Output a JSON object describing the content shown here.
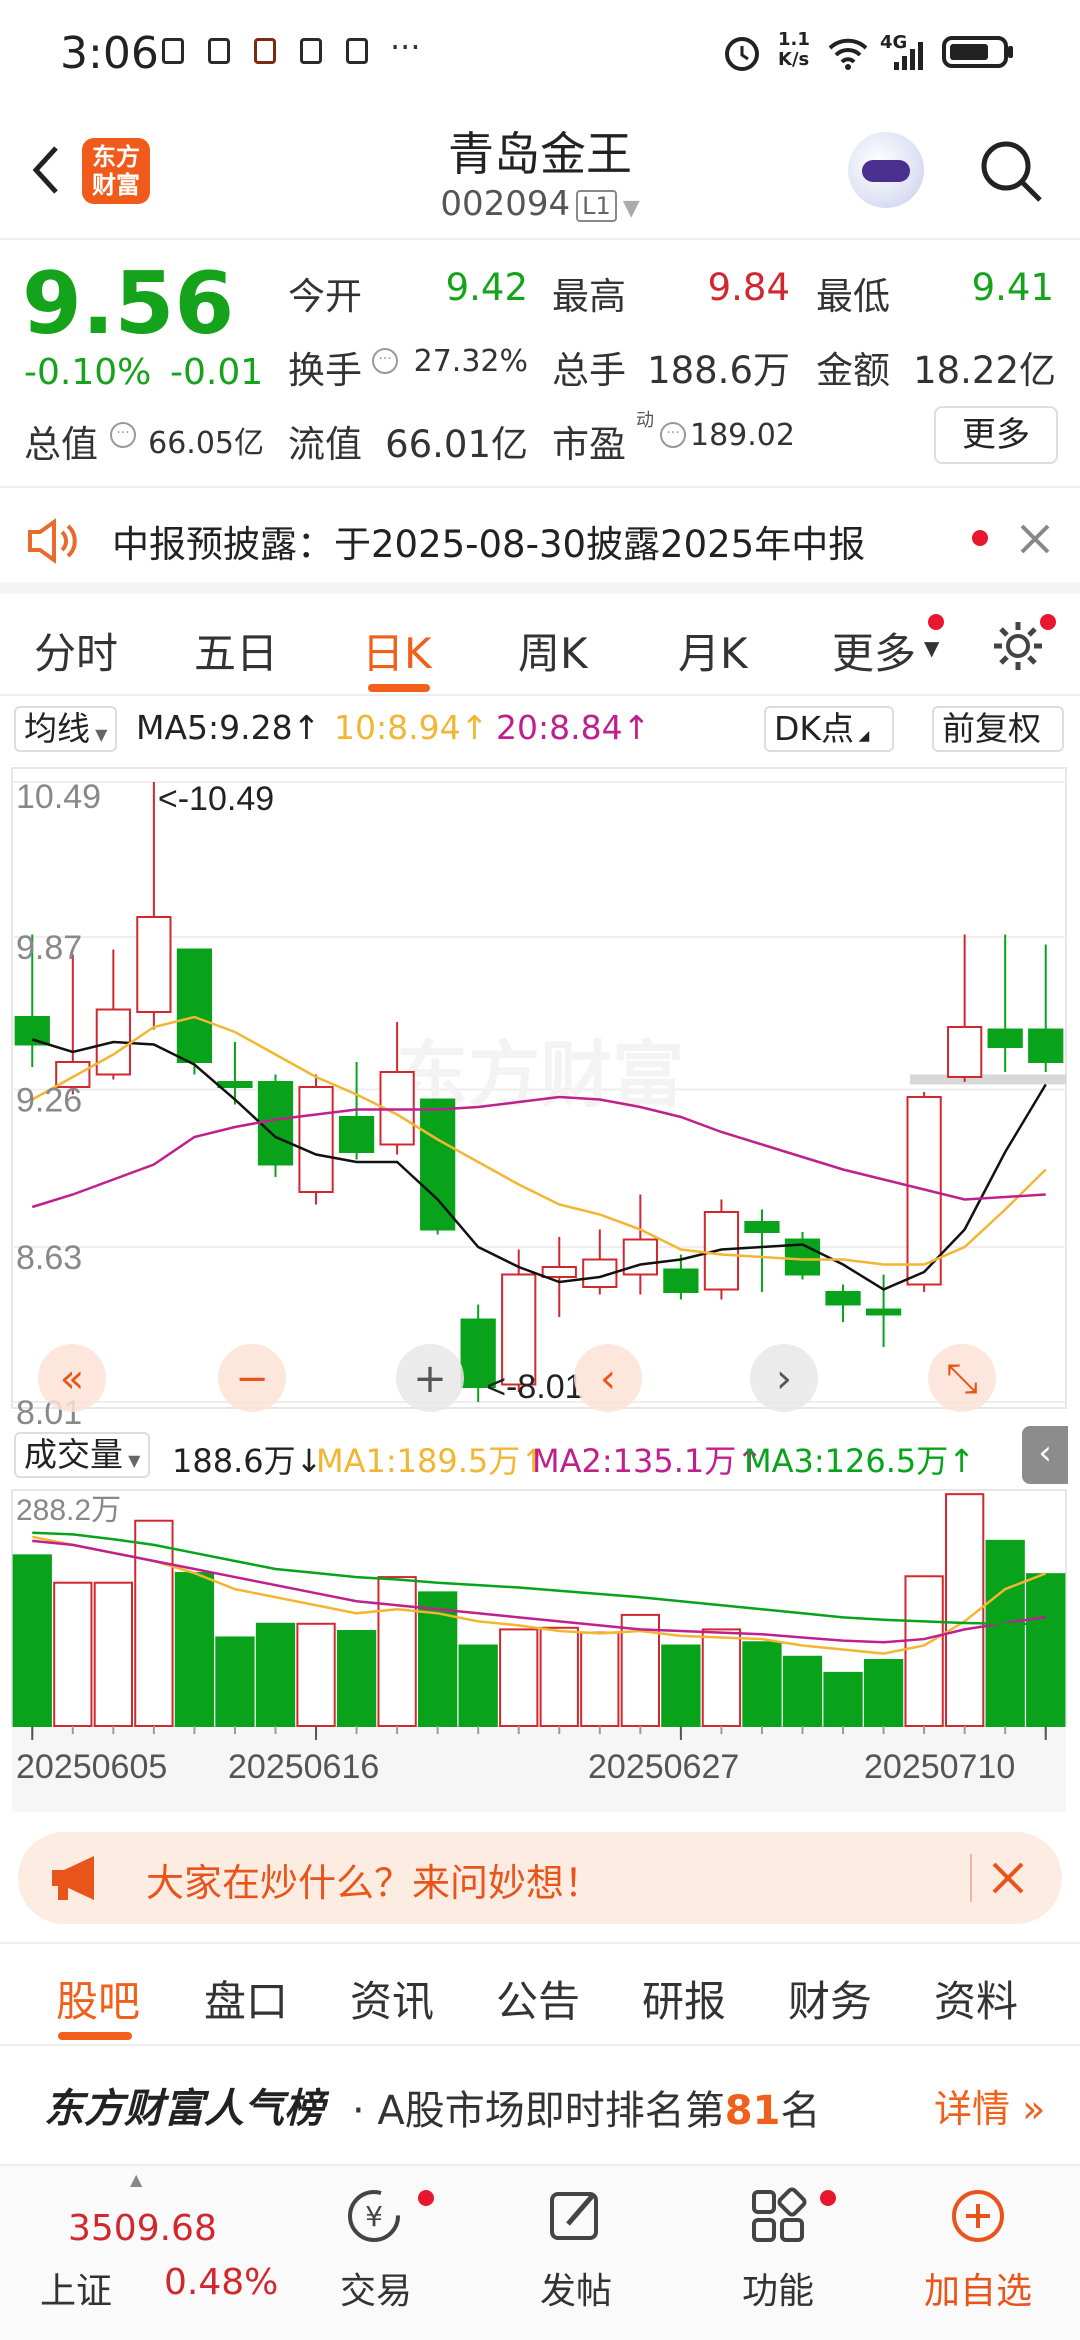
{
  "status_bar": {
    "time": "3:06",
    "net_speed": "1.1\nK/s",
    "network": "4G"
  },
  "header": {
    "logo_text": "东方\n财富",
    "stock_name": "青岛金王",
    "stock_code": "002094",
    "level": "L1"
  },
  "quote": {
    "price": "9.56",
    "change_pct": "-0.10%",
    "change": "-0.01",
    "open_label": "今开",
    "open": "9.42",
    "high_label": "最高",
    "high": "9.84",
    "low_label": "最低",
    "low": "9.41",
    "turnover_label": "换手",
    "turnover": "27.32%",
    "volume_label": "总手",
    "volume": "188.6万",
    "amount_label": "金额",
    "amount": "18.22亿",
    "mktcap_label": "总值",
    "mktcap": "66.05亿",
    "float_label": "流值",
    "float_cap": "66.01亿",
    "pe_label": "市盈",
    "pe_sup": "动",
    "pe": "189.02",
    "more": "更多"
  },
  "notice": {
    "text": "中报预披露：于2025-08-30披露2025年中报"
  },
  "period_tabs": [
    "分时",
    "五日",
    "日K",
    "周K",
    "月K",
    "更多"
  ],
  "active_period": "日K",
  "ma_row": {
    "selector": "均线",
    "ma5": "MA5:9.28",
    "ma10": "10:8.94",
    "ma20": "20:8.84",
    "dk": "DK点",
    "adjust": "前复权"
  },
  "vol_row": {
    "selector": "成交量",
    "vol": "188.6万",
    "ma1": "MA1:189.5万",
    "ma2": "MA2:135.1万",
    "ma3": "MA3:126.5万"
  },
  "colors": {
    "up": "#d0282e",
    "down": "#08a31a",
    "accent": "#f0601a",
    "ma5": "#111111",
    "ma10": "#f2b632",
    "ma20": "#c0208e"
  },
  "chart_data": {
    "type": "candlestick",
    "y_ticks": [
      "10.49",
      "9.87",
      "9.26",
      "8.63",
      "8.01"
    ],
    "ylim": [
      8.01,
      10.49
    ],
    "max_label": "<-10.49",
    "min_label": "<-8.01",
    "x_ticks": [
      "20250605",
      "20250616",
      "20250627",
      "20250710"
    ],
    "candles": [
      {
        "o": 9.55,
        "c": 9.44,
        "h": 9.88,
        "l": 9.35
      },
      {
        "o": 9.27,
        "c": 9.37,
        "h": 9.8,
        "l": 9.24
      },
      {
        "o": 9.32,
        "c": 9.58,
        "h": 9.82,
        "l": 9.3
      },
      {
        "o": 9.57,
        "c": 9.95,
        "h": 10.49,
        "l": 9.5
      },
      {
        "o": 9.82,
        "c": 9.37,
        "h": 9.82,
        "l": 9.32
      },
      {
        "o": 9.29,
        "c": 9.27,
        "h": 9.45,
        "l": 9.2
      },
      {
        "o": 9.29,
        "c": 8.96,
        "h": 9.32,
        "l": 8.91
      },
      {
        "o": 8.85,
        "c": 9.27,
        "h": 9.32,
        "l": 8.8
      },
      {
        "o": 9.15,
        "c": 9.01,
        "h": 9.37,
        "l": 8.98
      },
      {
        "o": 9.04,
        "c": 9.33,
        "h": 9.53,
        "l": 9.0
      },
      {
        "o": 9.22,
        "c": 8.7,
        "h": 9.22,
        "l": 8.68
      },
      {
        "o": 8.34,
        "c": 8.07,
        "h": 8.4,
        "l": 8.01
      },
      {
        "o": 8.08,
        "c": 8.52,
        "h": 8.62,
        "l": 8.05
      },
      {
        "o": 8.51,
        "c": 8.55,
        "h": 8.67,
        "l": 8.35
      },
      {
        "o": 8.47,
        "c": 8.58,
        "h": 8.7,
        "l": 8.44
      },
      {
        "o": 8.52,
        "c": 8.66,
        "h": 8.84,
        "l": 8.44
      },
      {
        "o": 8.54,
        "c": 8.45,
        "h": 8.6,
        "l": 8.42
      },
      {
        "o": 8.46,
        "c": 8.77,
        "h": 8.82,
        "l": 8.42
      },
      {
        "o": 8.73,
        "c": 8.69,
        "h": 8.78,
        "l": 8.45
      },
      {
        "o": 8.66,
        "c": 8.52,
        "h": 8.69,
        "l": 8.5
      },
      {
        "o": 8.45,
        "c": 8.4,
        "h": 8.48,
        "l": 8.33
      },
      {
        "o": 8.38,
        "c": 8.36,
        "h": 8.52,
        "l": 8.23
      },
      {
        "o": 8.48,
        "c": 9.23,
        "h": 9.25,
        "l": 8.45
      },
      {
        "o": 9.31,
        "c": 9.51,
        "h": 9.88,
        "l": 9.29
      },
      {
        "o": 9.5,
        "c": 9.43,
        "h": 9.88,
        "l": 9.33
      },
      {
        "o": 9.5,
        "c": 9.37,
        "h": 9.84,
        "l": 9.33
      }
    ],
    "ma5": [
      9.46,
      9.41,
      9.45,
      9.44,
      9.36,
      9.22,
      9.07,
      9.0,
      8.97,
      8.97,
      8.82,
      8.63,
      8.55,
      8.49,
      8.51,
      8.56,
      8.58,
      8.62,
      8.63,
      8.64,
      8.56,
      8.46,
      8.53,
      8.7,
      9.01,
      9.28
    ],
    "ma10": [
      9.22,
      9.31,
      9.4,
      9.51,
      9.55,
      9.49,
      9.4,
      9.31,
      9.24,
      9.16,
      9.06,
      8.97,
      8.88,
      8.8,
      8.76,
      8.7,
      8.62,
      8.6,
      8.59,
      8.58,
      8.58,
      8.56,
      8.56,
      8.63,
      8.78,
      8.94
    ],
    "ma20": [
      8.79,
      8.84,
      8.9,
      8.96,
      9.07,
      9.11,
      9.14,
      9.16,
      9.18,
      9.18,
      9.18,
      9.19,
      9.21,
      9.23,
      9.22,
      9.19,
      9.15,
      9.09,
      9.04,
      8.99,
      8.94,
      8.9,
      8.86,
      8.82,
      8.83,
      8.84
    ],
    "volume_max_label": "288.2万",
    "volume_max": 288.2,
    "volume": [
      212,
      178,
      178,
      255,
      190,
      110,
      127,
      127,
      118,
      185,
      166,
      100,
      120,
      122,
      116,
      138,
      100,
      120,
      104,
      86,
      66,
      82,
      186,
      288,
      230,
      188.6
    ],
    "vol_ma1": [
      235,
      225,
      215,
      205,
      190,
      170,
      160,
      150,
      140,
      145,
      140,
      130,
      125,
      118,
      115,
      118,
      112,
      110,
      108,
      100,
      95,
      90,
      100,
      130,
      170,
      189.5
    ],
    "vol_ma2": [
      230,
      225,
      215,
      205,
      195,
      185,
      175,
      165,
      155,
      150,
      145,
      140,
      135,
      130,
      125,
      120,
      118,
      116,
      114,
      110,
      106,
      104,
      108,
      120,
      128,
      135.1
    ],
    "vol_ma3": [
      240,
      238,
      232,
      225,
      215,
      205,
      195,
      190,
      185,
      182,
      178,
      175,
      172,
      168,
      164,
      160,
      155,
      150,
      145,
      140,
      135,
      132,
      130,
      128,
      127,
      126.5
    ]
  },
  "chart_controls": [
    "«",
    "−",
    "+",
    "‹",
    "›",
    "⤡"
  ],
  "ad": {
    "text": "大家在炒什么？来问妙想！"
  },
  "sub_tabs": [
    "股吧",
    "盘口",
    "资讯",
    "公告",
    "研报",
    "财务",
    "资料"
  ],
  "rank": {
    "brand": "东方财富人气榜",
    "text_before": "· A股市场即时排名第",
    "rank_num": "81",
    "text_after": "名",
    "detail": "详情"
  },
  "bottom_bar": {
    "index_value": "3509.68",
    "index_name": "上证",
    "index_change": "0.48%",
    "trade": "交易",
    "post": "发帖",
    "func": "功能",
    "add": "加自选"
  },
  "watermark": "东方财富"
}
